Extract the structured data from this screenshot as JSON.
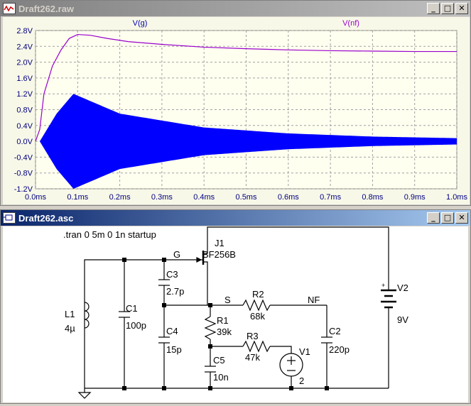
{
  "plot_window": {
    "title": "Draft262.raw",
    "buttons": [
      "_",
      "□",
      "✕"
    ]
  },
  "schematic_window": {
    "title": "Draft262.asc",
    "buttons": [
      "_",
      "□",
      "✕"
    ]
  },
  "chart_data": {
    "type": "line",
    "series": [
      {
        "name": "V(g)",
        "color": "#0000ff",
        "description_points": [
          [
            0,
            0
          ],
          [
            0.01,
            0.0
          ],
          [
            0.05,
            0.7
          ],
          [
            0.09,
            1.2
          ],
          [
            0.2,
            0.7
          ],
          [
            0.4,
            0.35
          ],
          [
            0.6,
            0.2
          ],
          [
            0.8,
            0.12
          ],
          [
            1.0,
            0.08
          ]
        ]
      },
      {
        "name": "V(nf)",
        "color": "#9900cc",
        "x": [
          0,
          0.01,
          0.02,
          0.04,
          0.06,
          0.08,
          0.1,
          0.13,
          0.17,
          0.22,
          0.3,
          0.4,
          0.5,
          0.6,
          0.7,
          0.8,
          0.9,
          1.0
        ],
        "y": [
          0,
          0.3,
          1.2,
          1.9,
          2.3,
          2.6,
          2.7,
          2.68,
          2.6,
          2.52,
          2.45,
          2.38,
          2.34,
          2.31,
          2.29,
          2.28,
          2.27,
          2.27
        ]
      }
    ],
    "x_ticks": [
      "0.0ms",
      "0.1ms",
      "0.2ms",
      "0.3ms",
      "0.4ms",
      "0.5ms",
      "0.6ms",
      "0.7ms",
      "0.8ms",
      "0.9ms",
      "1.0ms"
    ],
    "y_ticks": [
      "2.8V",
      "2.4V",
      "2.0V",
      "1.6V",
      "1.2V",
      "0.8V",
      "0.4V",
      "0.0V",
      "-0.4V",
      "-0.8V",
      "-1.2V"
    ],
    "xlim": [
      0,
      1.0
    ],
    "ylim": [
      -1.2,
      2.8
    ],
    "grid": true
  },
  "schematic": {
    "directive": ".tran 0 5m 0 1n startup",
    "components": {
      "J1": {
        "ref": "J1",
        "value": "BF256B"
      },
      "L1": {
        "ref": "L1",
        "value": "4µ"
      },
      "C1": {
        "ref": "C1",
        "value": "100p"
      },
      "C3": {
        "ref": "C3",
        "value": "2.7p"
      },
      "C4": {
        "ref": "C4",
        "value": "15p"
      },
      "R1": {
        "ref": "R1",
        "value": "39k"
      },
      "C5": {
        "ref": "C5",
        "value": "10n"
      },
      "R2": {
        "ref": "R2",
        "value": "68k"
      },
      "R3": {
        "ref": "R3",
        "value": "47k"
      },
      "V1": {
        "ref": "V1",
        "value": "2"
      },
      "C2": {
        "ref": "C2",
        "value": "220p"
      },
      "V2": {
        "ref": "V2",
        "value": "9V"
      }
    },
    "nets": {
      "G": "G",
      "S": "S",
      "NF": "NF"
    },
    "plus": "+"
  }
}
